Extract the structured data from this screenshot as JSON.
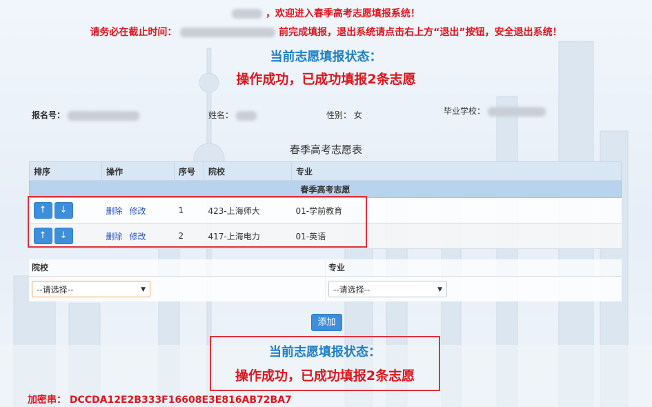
{
  "header": {
    "welcome": "，欢迎进入春季高考志愿填报系统！",
    "deadline_prefix": "请务必在截止时间：",
    "deadline_suffix": "前完成填报，退出系统请点击右上方“退出”按钮，安全退出系统！"
  },
  "status_top": {
    "title": "当前志愿填报状态：",
    "message": "操作成功，已成功填报2条志愿"
  },
  "info": {
    "reg_no_label": "报名号：",
    "name_label": "姓名：",
    "gender_label": "性别：",
    "gender_value": "女",
    "school_label": "毕业学校："
  },
  "table": {
    "caption": "春季高考志愿表",
    "headers": [
      "排序",
      "操作",
      "序号",
      "院校",
      "专业"
    ],
    "group_label": "春季高考志愿",
    "rows": [
      {
        "up": "↑",
        "down": "↓",
        "delete": "删除",
        "edit": "修改",
        "index": "1",
        "school": "423-上海师大",
        "major": "01-学前教育"
      },
      {
        "up": "↑",
        "down": "↓",
        "delete": "删除",
        "edit": "修改",
        "index": "2",
        "school": "417-上海电力",
        "major": "01-英语"
      }
    ]
  },
  "form": {
    "school_label": "院校",
    "major_label": "专业",
    "school_select": "--请选择--",
    "major_select": "--请选择--",
    "add_button": "添加"
  },
  "status_bottom": {
    "title": "当前志愿填报状态：",
    "message": "操作成功，已成功填报2条志愿"
  },
  "secret": {
    "label": "加密串：",
    "value": "DCCDA12E2B333F16608E3E816AB72BA7"
  },
  "colors": {
    "alert_red": "#e0141e",
    "title_blue": "#1f7fc8",
    "button_blue": "#3d8fdb",
    "header_bg": "#d9e6f4",
    "group_bg": "#b9d3ee"
  }
}
